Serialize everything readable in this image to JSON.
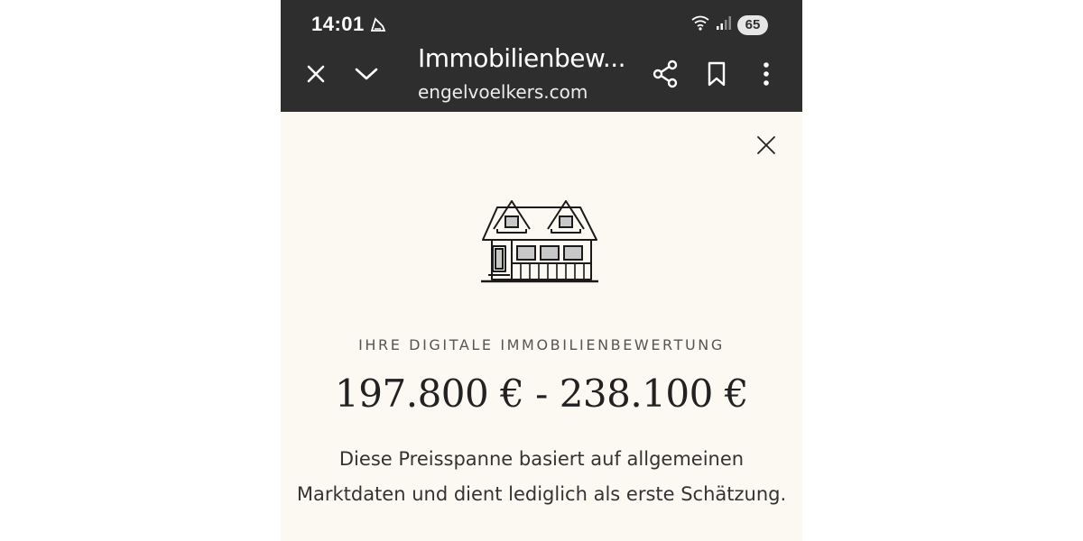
{
  "status_bar": {
    "time": "14:01",
    "battery": "65",
    "icons": [
      "app-notification-icon",
      "wifi-icon",
      "signal-icon"
    ]
  },
  "browser": {
    "title": "Immobilienbew...",
    "url": "engelvoelkers.com",
    "icons": [
      "close-icon",
      "chevron-down-icon",
      "share-icon",
      "bookmark-icon",
      "more-vert-icon"
    ]
  },
  "modal": {
    "icon": "house-icon",
    "overline": "IHRE DIGITALE IMMOBILIENBEWERTUNG",
    "price_range": "197.800 € - 238.100 €",
    "description_line1": "Diese Preisspanne basiert auf allgemeinen",
    "description_line2": "Marktdaten und dient lediglich als erste Schätzung."
  },
  "colors": {
    "toolbar": "#2e2e2e",
    "background": "#fcf9f3",
    "text": "#222222"
  }
}
